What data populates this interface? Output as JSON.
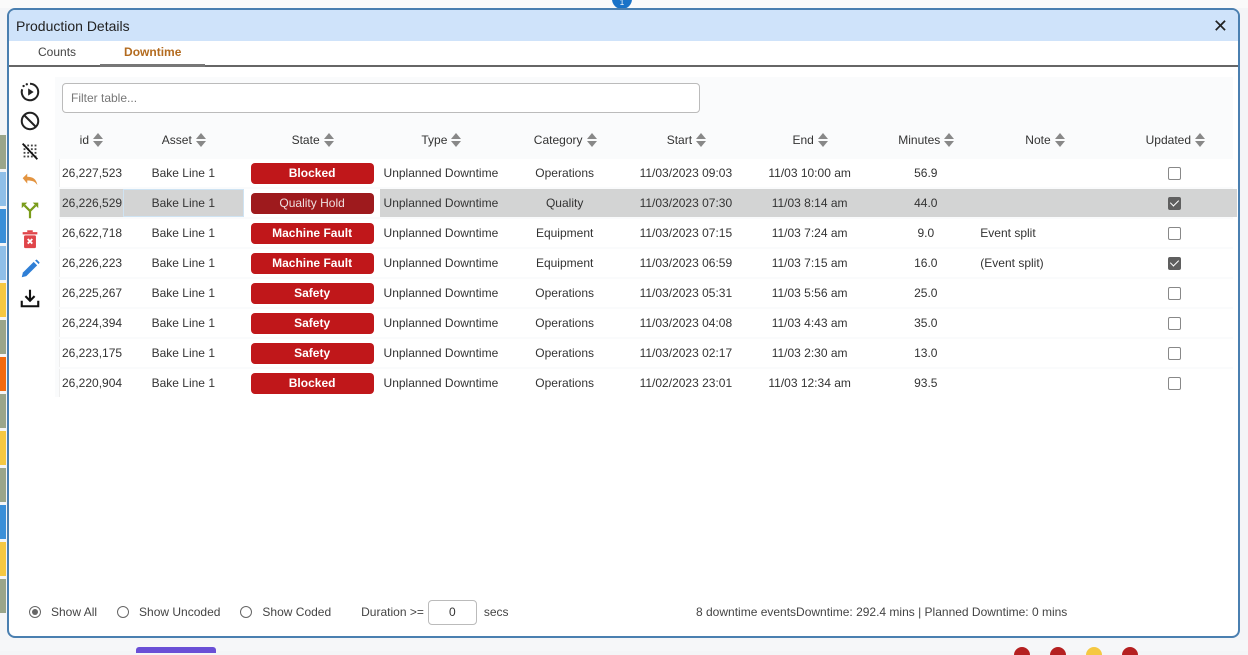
{
  "background": {
    "badge": "1",
    "left_strip_colors": [
      "#9aa58a",
      "#8fbfe8",
      "#3a8fd8",
      "#8fbfe8",
      "#f5c842",
      "#9aa58a",
      "#f26a0f",
      "#9aa58a",
      "#f5c842",
      "#9aa58a",
      "#3a8fd8",
      "#f5c842",
      "#9aa58a"
    ],
    "bottom_dot_colors": [
      "#b52021",
      "#b52021",
      "#f5c842",
      "#b52021"
    ]
  },
  "dialog": {
    "title": "Production Details",
    "close_icon": "close-icon",
    "tabs": [
      {
        "label": "Counts",
        "active": false
      },
      {
        "label": "Downtime",
        "active": true
      }
    ]
  },
  "toolbar": [
    {
      "name": "play-circle-icon",
      "color": "#222"
    },
    {
      "name": "ban-icon",
      "color": "#222"
    },
    {
      "name": "clear-selection-icon",
      "color": "#222"
    },
    {
      "name": "undo-icon",
      "color": "#e39440"
    },
    {
      "name": "split-icon",
      "color": "#7a9c1a"
    },
    {
      "name": "delete-icon",
      "color": "#e0454a"
    },
    {
      "name": "edit-icon",
      "color": "#2f7fd6"
    },
    {
      "name": "download-icon",
      "color": "#222"
    }
  ],
  "filter": {
    "placeholder": "Filter table...",
    "value": ""
  },
  "table": {
    "columns": [
      "id",
      "Asset",
      "State",
      "Type",
      "Category",
      "Start",
      "End",
      "Minutes",
      "Note",
      "Updated"
    ],
    "rows": [
      {
        "id": "26,227,523",
        "asset": "Bake Line 1",
        "state": "Blocked",
        "type": "Unplanned Downtime",
        "category": "Operations",
        "start": "11/03/2023 09:03",
        "end": "11/03 10:00 am",
        "minutes": "56.9",
        "note": "",
        "updated": false,
        "selected": false
      },
      {
        "id": "26,226,529",
        "asset": "Bake Line 1",
        "state": "Quality Hold",
        "type": "Unplanned Downtime",
        "category": "Quality",
        "start": "11/03/2023 07:30",
        "end": "11/03 8:14 am",
        "minutes": "44.0",
        "note": "",
        "updated": true,
        "selected": true
      },
      {
        "id": "26,622,718",
        "asset": "Bake Line 1",
        "state": "Machine Fault",
        "type": "Unplanned Downtime",
        "category": "Equipment",
        "start": "11/03/2023 07:15",
        "end": "11/03 7:24 am",
        "minutes": "9.0",
        "note": "Event split",
        "updated": false,
        "selected": false
      },
      {
        "id": "26,226,223",
        "asset": "Bake Line 1",
        "state": "Machine Fault",
        "type": "Unplanned Downtime",
        "category": "Equipment",
        "start": "11/03/2023 06:59",
        "end": "11/03 7:15 am",
        "minutes": "16.0",
        "note": "(Event split)",
        "updated": true,
        "selected": false
      },
      {
        "id": "26,225,267",
        "asset": "Bake Line 1",
        "state": "Safety",
        "type": "Unplanned Downtime",
        "category": "Operations",
        "start": "11/03/2023 05:31",
        "end": "11/03 5:56 am",
        "minutes": "25.0",
        "note": "",
        "updated": false,
        "selected": false
      },
      {
        "id": "26,224,394",
        "asset": "Bake Line 1",
        "state": "Safety",
        "type": "Unplanned Downtime",
        "category": "Operations",
        "start": "11/03/2023 04:08",
        "end": "11/03 4:43 am",
        "minutes": "35.0",
        "note": "",
        "updated": false,
        "selected": false
      },
      {
        "id": "26,223,175",
        "asset": "Bake Line 1",
        "state": "Safety",
        "type": "Unplanned Downtime",
        "category": "Operations",
        "start": "11/03/2023 02:17",
        "end": "11/03 2:30 am",
        "minutes": "13.0",
        "note": "",
        "updated": false,
        "selected": false
      },
      {
        "id": "26,220,904",
        "asset": "Bake Line 1",
        "state": "Blocked",
        "type": "Unplanned Downtime",
        "category": "Operations",
        "start": "11/02/2023 23:01",
        "end": "11/03 12:34 am",
        "minutes": "93.5",
        "note": "",
        "updated": false,
        "selected": false
      }
    ]
  },
  "footer": {
    "radios": [
      {
        "label": "Show All",
        "checked": true
      },
      {
        "label": "Show Uncoded",
        "checked": false
      },
      {
        "label": "Show Coded",
        "checked": false
      }
    ],
    "duration_label": "Duration >=",
    "duration_value": "0",
    "duration_unit": "secs",
    "summary": "8 downtime eventsDowntime: 292.4 mins | Planned Downtime: 0 mins"
  }
}
